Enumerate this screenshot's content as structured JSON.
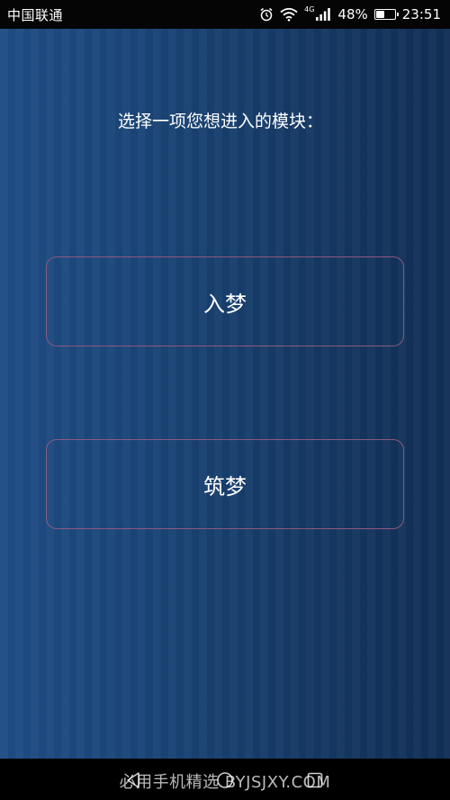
{
  "status_bar": {
    "carrier": "中国联通",
    "network_type": "4G",
    "battery_percent": "48%",
    "battery_level": 0.48,
    "time": "23:51",
    "icons": [
      "alarm-icon",
      "wifi-icon",
      "signal-icon",
      "battery-icon"
    ]
  },
  "main": {
    "prompt": "选择一项您想进入的模块：",
    "buttons": [
      {
        "label": "入梦"
      },
      {
        "label": "筑梦"
      }
    ]
  },
  "nav_bar": {
    "icons": [
      "back-icon",
      "home-icon",
      "recent-apps-icon"
    ],
    "watermark": "必用手机精选 BYJSJXY.COM"
  },
  "colors": {
    "background_left": "#1f4d86",
    "background_right": "#122f56",
    "button_border": "#8c5a7e",
    "text": "#ffffff"
  }
}
